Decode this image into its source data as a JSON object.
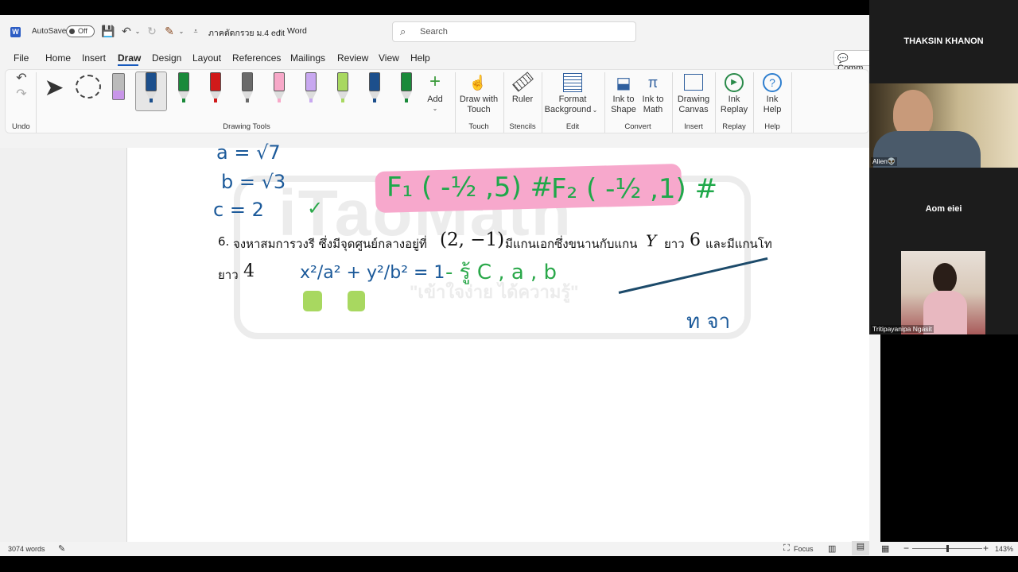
{
  "titlebar": {
    "app_icon": "word-icon",
    "autosave_label": "AutoSave",
    "autosave_state": "Off",
    "doc_title": "ภาคตัดกรวย ม.4 edit",
    "app_name": "Word",
    "search_placeholder": "Search"
  },
  "menu": {
    "items": [
      "File",
      "Home",
      "Insert",
      "Draw",
      "Design",
      "Layout",
      "References",
      "Mailings",
      "Review",
      "View",
      "Help"
    ],
    "active": "Draw",
    "comments_label": "Comm"
  },
  "ribbon": {
    "undo_group": "Undo",
    "drawing_tools_group": "Drawing Tools",
    "add_label": "Add",
    "draw_with_touch": [
      "Draw with",
      "Touch"
    ],
    "touch_group": "Touch",
    "ruler": "Ruler",
    "stencils_group": "Stencils",
    "format_background": [
      "Format",
      "Background"
    ],
    "edit_group": "Edit",
    "ink_to_shape": [
      "Ink to",
      "Shape"
    ],
    "ink_to_math": [
      "Ink to",
      "Math"
    ],
    "convert_group": "Convert",
    "drawing_canvas": [
      "Drawing",
      "Canvas"
    ],
    "insert_group": "Insert",
    "ink_replay": [
      "Ink",
      "Replay"
    ],
    "replay_group": "Replay",
    "ink_help": [
      "Ink",
      "Help"
    ],
    "help_group": "Help",
    "pen_colors": [
      "#8a8a8a",
      "#1c4f8c",
      "#1a8a3a",
      "#d01a1a",
      "#6a6a6a",
      "#f7a8c8",
      "#c8a8f0",
      "#a8d860",
      "#1c4f8c",
      "#1a8a3a"
    ]
  },
  "document": {
    "line_a": "a = √7",
    "line_b": "b = √3",
    "line_c": "c = 2",
    "foci_1": "F₁ ( -½ ,5) #",
    "foci_2": "F₂ ( -½ ,1) #",
    "question_number": "6.",
    "question_text_1": "จงหาสมการวงรี ซึ่งมีจุดศูนย์กลางอยู่ที่",
    "question_center": "(2, −1)",
    "question_text_2": "มีแกนเอกซึ่งขนานกับแกน",
    "question_axis": "Y",
    "question_text_3": "ยาว",
    "question_major": "6",
    "question_text_4": "และมีแกนโท",
    "question_text_5": "ยาว",
    "question_minor": "4",
    "ink_equation": "x²/a² + y²/b² = 1",
    "ink_note": "- รู้ C , a , b",
    "ink_right": "ท จา",
    "watermark": "iTaoMath",
    "watermark_sub": "\"เข้าใจง่าย ได้ความรู้\""
  },
  "statusbar": {
    "words": "3074 words",
    "focus": "Focus",
    "zoom": "143%"
  },
  "video": {
    "tiles": [
      {
        "name": "THAKSIN KHANON",
        "tag": ""
      },
      {
        "name": "",
        "tag": "Alien👽"
      },
      {
        "name": "Aom eiei",
        "tag": ""
      },
      {
        "name": "",
        "tag": "Tritipayanipa Ngasit"
      }
    ]
  }
}
